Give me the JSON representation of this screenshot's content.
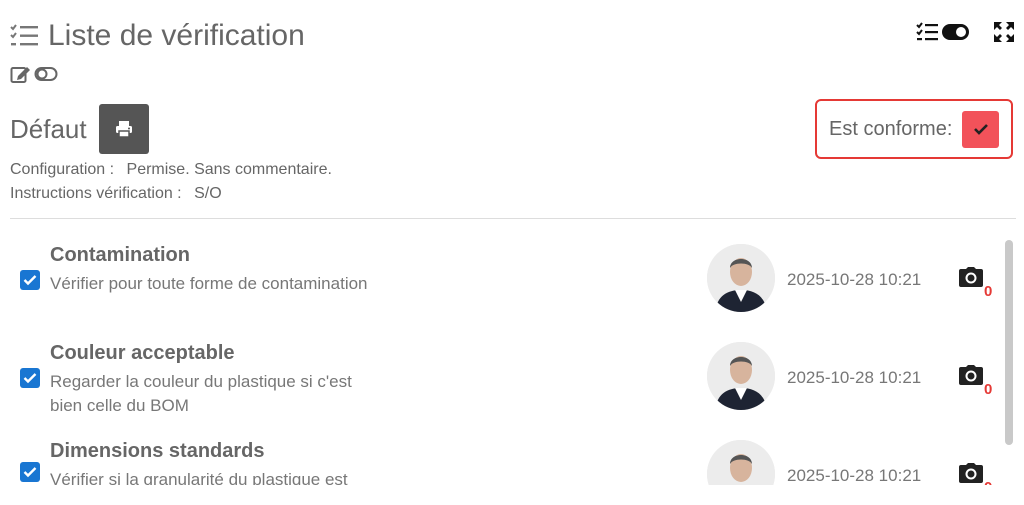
{
  "header": {
    "title": "Liste de vérification"
  },
  "section": {
    "title": "Défaut",
    "conform_label": "Est conforme:",
    "config_key": "Configuration :",
    "config_value": "Permise. Sans commentaire.",
    "instructions_key": "Instructions vérification :",
    "instructions_value": "S/O"
  },
  "items": [
    {
      "name": "Contamination",
      "description": "Vérifier pour toute forme de contamination",
      "timestamp": "2025-10-28 10:21",
      "photo_count": "0",
      "checked": true
    },
    {
      "name": "Couleur acceptable",
      "description": "Regarder la couleur du plastique si c'est bien celle du BOM",
      "timestamp": "2025-10-28 10:21",
      "photo_count": "0",
      "checked": true
    },
    {
      "name": "Dimensions standards",
      "description": "Vérifier si la granularité du plastique est",
      "timestamp": "2025-10-28 10:21",
      "photo_count": "0",
      "checked": true
    }
  ],
  "colors": {
    "checkbox": "#1976d2",
    "conform_button": "#f2525a",
    "highlight_border": "#e53935",
    "photo_count": "#e53935",
    "print_button": "#555555"
  },
  "icons": {
    "title": "checklist-icon",
    "edit": "edit-icon",
    "toggle_small": "toggle-icon",
    "checklist_toggle": "checklist-toggle-icon",
    "expand": "expand-icon",
    "print": "print-icon",
    "check": "check-icon",
    "camera": "camera-icon"
  }
}
